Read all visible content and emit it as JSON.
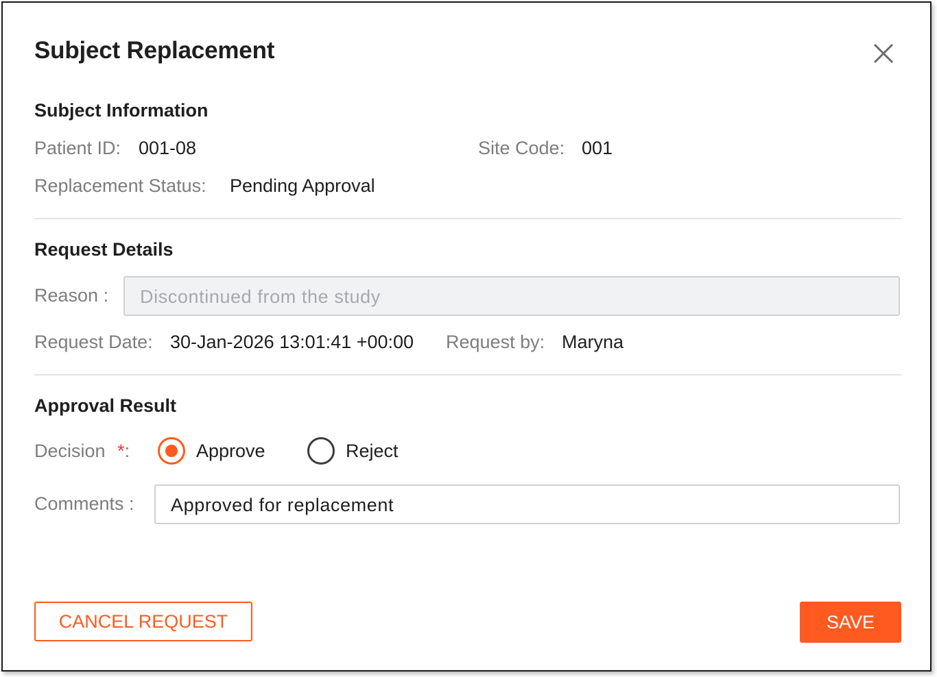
{
  "dialog": {
    "title": "Subject Replacement"
  },
  "subject_info": {
    "heading": "Subject Information",
    "patient_id_label": "Patient ID:",
    "patient_id_value": "001-08",
    "site_code_label": "Site Code:",
    "site_code_value": "001",
    "status_label": "Replacement Status:",
    "status_value": "Pending Approval"
  },
  "request_details": {
    "heading": "Request Details",
    "reason_label": "Reason :",
    "reason_value": "Discontinued from the study",
    "request_date_label": "Request Date:",
    "request_date_value": "30-Jan-2026 13:01:41 +00:00",
    "request_by_label": "Request by:",
    "request_by_value": "Maryna"
  },
  "approval": {
    "heading": "Approval Result",
    "decision_label": "Decision",
    "required_mark": "*",
    "decision_colon": ":",
    "options": [
      {
        "label": "Approve",
        "selected": true
      },
      {
        "label": "Reject",
        "selected": false
      }
    ],
    "comments_label": "Comments :",
    "comments_value": "Approved for replacement"
  },
  "actions": {
    "cancel_label": "CANCEL REQUEST",
    "save_label": "SAVE"
  },
  "colors": {
    "accent": "#ff5a1f",
    "required": "#e53935"
  },
  "icons": {
    "close": "close-icon"
  }
}
